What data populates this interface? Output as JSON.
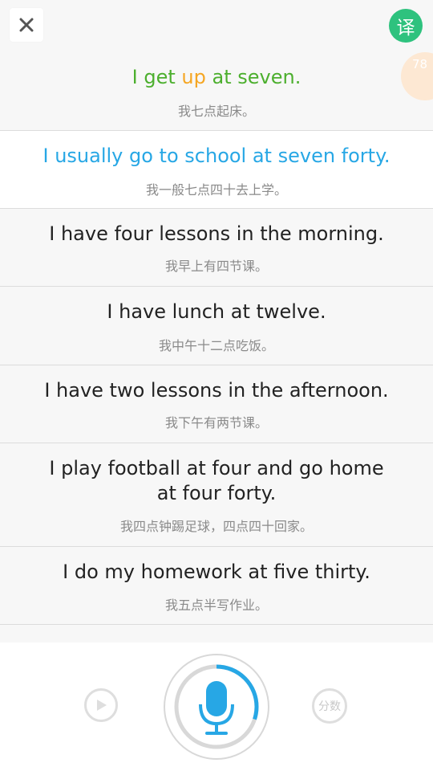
{
  "header": {
    "close_icon": "close-icon",
    "translate_label": "译",
    "score": "78"
  },
  "sentences": [
    {
      "en_parts": [
        {
          "text": "I get ",
          "color": "#4caf2e"
        },
        {
          "text": "up",
          "color": "#f5a623"
        },
        {
          "text": " at seven.",
          "color": "#4caf2e"
        }
      ],
      "en_line1": "",
      "en_line2": "",
      "zh": "我七点起床。"
    },
    {
      "en_line1": "I usually go to school at seven forty.",
      "zh": "我一般七点四十去上学。",
      "active": true
    },
    {
      "en_line1": "I have four lessons in the morning.",
      "zh": "我早上有四节课。"
    },
    {
      "en_line1": "I have lunch at twelve.",
      "zh": "我中午十二点吃饭。"
    },
    {
      "en_line1": "I have two lessons in the afternoon.",
      "zh": "我下午有两节课。"
    },
    {
      "en_line1": "I play football at four and go home",
      "en_line2": "at four forty.",
      "zh": "我四点钟踢足球，四点四十回家。"
    },
    {
      "en_line1": "I do my homework at five thirty.",
      "zh": "我五点半写作业。"
    }
  ],
  "bottom": {
    "play_icon": "play-icon",
    "mic_icon": "microphone-icon",
    "score_label": "分数",
    "record_progress": 0.3
  },
  "colors": {
    "accent_blue": "#27a7e5",
    "green": "#4caf2e",
    "orange": "#f5a623",
    "translate_bg": "#2ec27e"
  }
}
